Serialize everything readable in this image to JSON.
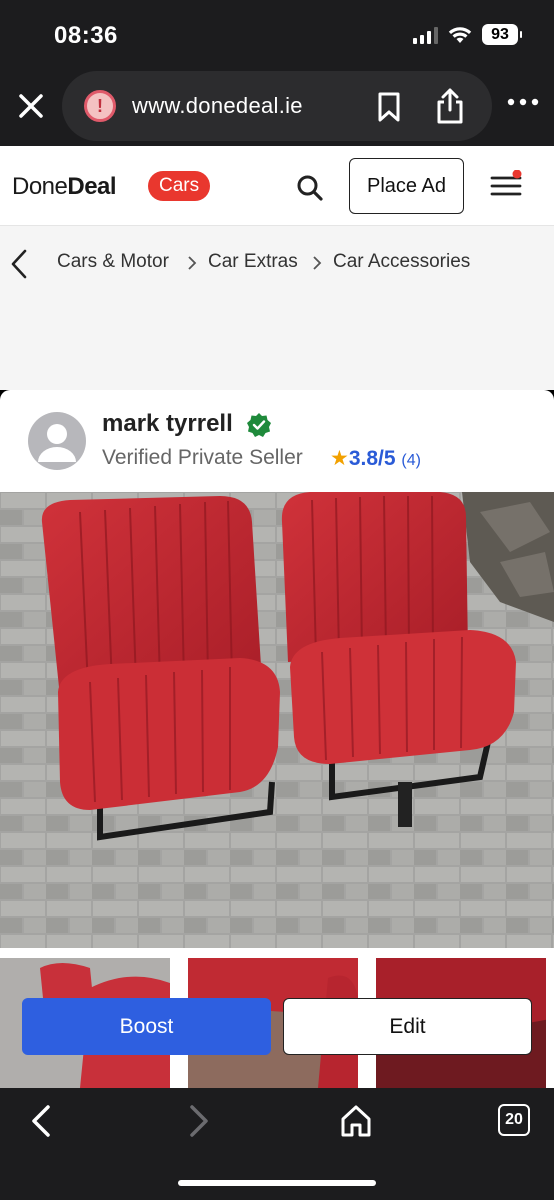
{
  "status_bar": {
    "time": "08:36",
    "battery": "93"
  },
  "browser": {
    "url": "www.donedeal.ie",
    "icons": [
      "close-icon",
      "warning-icon",
      "bookmark-icon",
      "share-icon",
      "more-icon"
    ],
    "tab_count": "20",
    "bottom_icons": [
      "back-icon",
      "forward-icon",
      "home-icon",
      "tabs-icon"
    ]
  },
  "header": {
    "logo_regular": "Done",
    "logo_bold": "Deal",
    "badge": "Cars",
    "place_ad": "Place Ad",
    "icons": [
      "search-icon",
      "hamburger-menu-icon"
    ],
    "brand_color": "#e9372e"
  },
  "breadcrumb": {
    "items": [
      "Cars & Motor",
      "Car Extras",
      "Car Accessories"
    ]
  },
  "seller": {
    "name": "mark tyrrell",
    "type": "Verified Private Seller",
    "rating": "3.8/5",
    "rating_star": "★",
    "review_count": "(4)",
    "verified_color": "#1f8a3b"
  },
  "listing": {
    "image_subject": "two red leather car seats",
    "thumbnail_count": 3
  },
  "actions": {
    "boost": "Boost",
    "edit": "Edit",
    "boost_color": "#2e5fe0"
  }
}
